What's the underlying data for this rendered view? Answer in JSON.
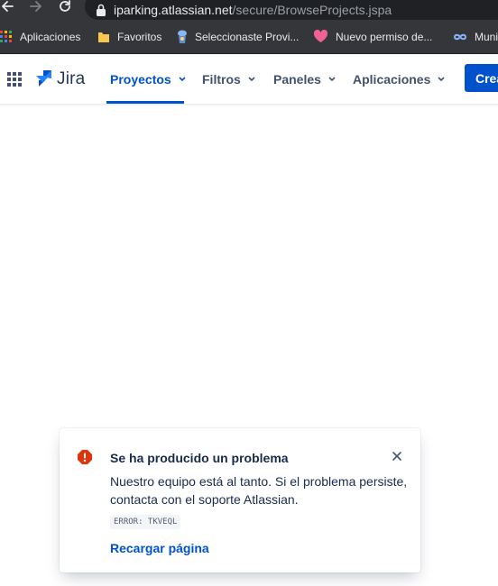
{
  "browser": {
    "url_host": "iparking.atlassian.net",
    "url_path": "/secure/BrowseProjects.jspa",
    "bookmarks": [
      {
        "label": "Aplicaciones",
        "icon": "apps-grid-icon"
      },
      {
        "label": "Favoritos",
        "icon": "folder-icon"
      },
      {
        "label": "Seleccionaste Provi...",
        "icon": "shield-badge-icon"
      },
      {
        "label": "Nuevo permiso de...",
        "icon": "heart-icon"
      },
      {
        "label": "Muni",
        "icon": "infinity-icon"
      }
    ]
  },
  "header": {
    "logo_text": "Jira",
    "nav": [
      {
        "label": "Proyectos",
        "active": true
      },
      {
        "label": "Filtros"
      },
      {
        "label": "Paneles"
      },
      {
        "label": "Aplicaciones"
      }
    ],
    "create_label": "Crear",
    "colors": {
      "brand": "#0052cc",
      "nav_text": "#42526e"
    }
  },
  "flag": {
    "title": "Se ha producido un problema",
    "description": "Nuestro equipo está al tanto. Si el problema persiste, contacta con el soporte Atlassian.",
    "error_code": "ERROR: TKVEQL",
    "action_label": "Recargar página",
    "colors": {
      "error_icon": "#de350b",
      "link": "#0052cc"
    }
  }
}
